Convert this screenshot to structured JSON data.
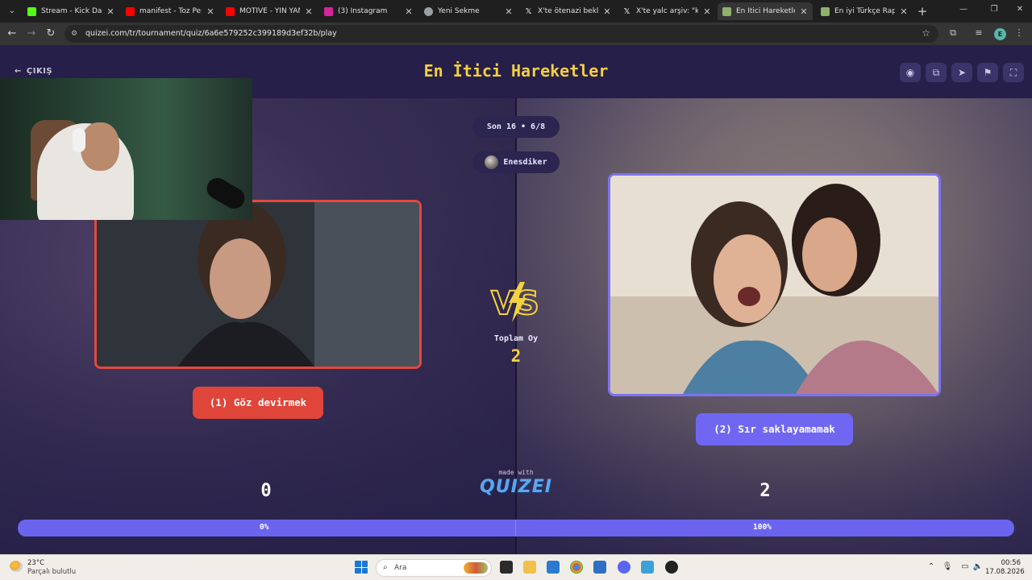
{
  "browser": {
    "tabs": [
      {
        "title": "Stream - Kick Dashbo",
        "favicon_color": "#53fc18",
        "active": false
      },
      {
        "title": "manifest - Toz Pembe",
        "favicon_color": "#ff0000",
        "active": false
      },
      {
        "title": "MOTIVE - YIN YANG (",
        "favicon_color": "#ff0000",
        "active": false
      },
      {
        "title": "(3) Instagram",
        "favicon_color": "#d6249f",
        "active": false
      },
      {
        "title": "Yeni Sekme",
        "favicon_color": "#9aa0a6",
        "active": false
      },
      {
        "title": "X'te ötenazi bekliyor",
        "favicon_color": "#ffffff",
        "active": false
      },
      {
        "title": "X'te yalc arşiv: \"kurtla",
        "favicon_color": "#ffffff",
        "active": false
      },
      {
        "title": "En İtici Hareketler - T",
        "favicon_color": "#8fb06a",
        "active": true
      },
      {
        "title": "En iyi Türkçe Rap Şarl",
        "favicon_color": "#8fb06a",
        "active": false
      }
    ],
    "url": "quizei.com/tr/tournament/quiz/6a6e579252c399189d3ef32b/play",
    "profile_initial": "E"
  },
  "header": {
    "exit_label": "ÇIKIŞ",
    "title": "En İtici Hareketler",
    "buttons": [
      "eye-icon",
      "copy-icon",
      "send-icon",
      "flag-icon",
      "fullscreen-icon"
    ]
  },
  "round": {
    "label": "Son 16 • 6/8",
    "username": "Enesdiker"
  },
  "options": {
    "left": {
      "label": "(1) Göz devirmek",
      "votes": "0",
      "percent": "0%",
      "accent": "#e3493d"
    },
    "right": {
      "label": "(2) Sır saklayamamak",
      "votes": "2",
      "percent": "100%",
      "accent": "#7b73f0"
    }
  },
  "totals": {
    "label": "Toplam Oy",
    "value": "2",
    "vs": "VS"
  },
  "branding": {
    "made_with": "made with",
    "logo": "QUIZEI"
  },
  "progress": {
    "left_fraction": 0.0,
    "right_fraction": 1.0
  },
  "taskbar": {
    "weather_temp": "23°C",
    "weather_desc": "Parçalı bulutlu",
    "search_placeholder": "Ara",
    "time": "00:56",
    "date": "17.08.2026"
  }
}
